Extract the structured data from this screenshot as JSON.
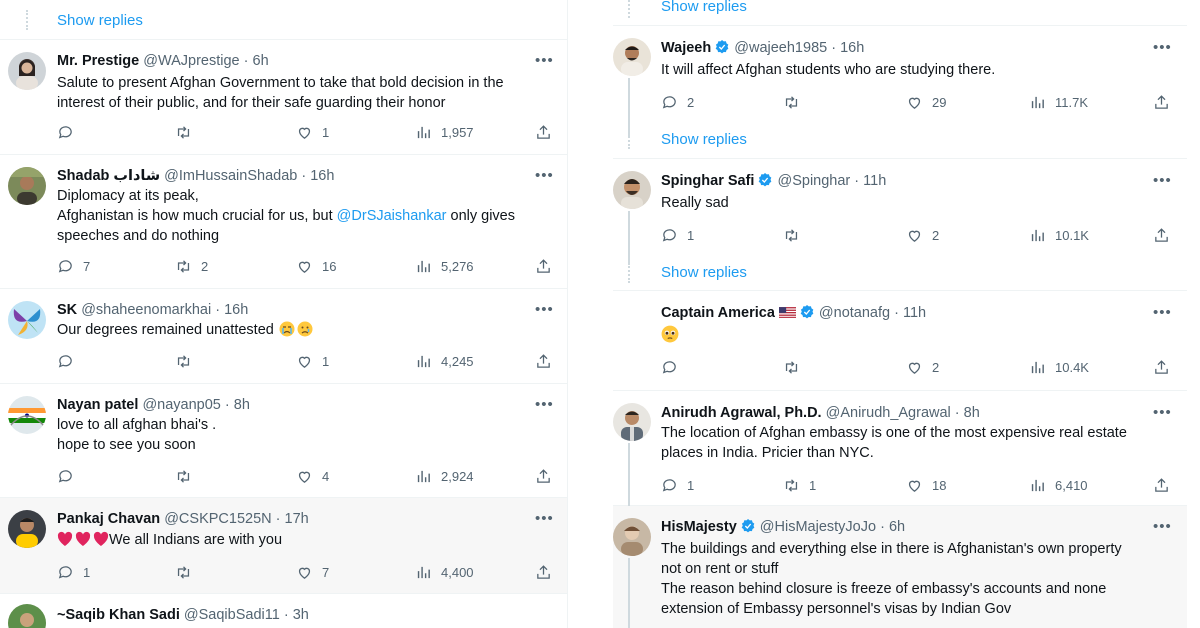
{
  "colors": {
    "accent": "#1d9bf0",
    "muted": "#536471",
    "text": "#0f1419",
    "like_red": "#f91880"
  },
  "left": {
    "show_replies": "Show replies",
    "tweets": [
      {
        "name": "Mr. Prestige",
        "handle": "@WAJprestige",
        "time": "6h",
        "lines": [
          "Salute to present Afghan Government to take that bold decision in the",
          "interest of their public, and for their safe guarding their honor"
        ],
        "replies": "",
        "retweets": "",
        "likes": "1",
        "views": "1,957"
      },
      {
        "name": "Shadab شاداب",
        "handle": "@ImHussainShadab",
        "time": "16h",
        "line1": "Diplomacy at its peak,",
        "line2_pre": "Afghanistan is how much crucial for us, but ",
        "mention": "@DrSJaishankar",
        "line2_post": " only gives",
        "line3": "speeches and do nothing",
        "replies": "7",
        "retweets": "2",
        "likes": "16",
        "views": "5,276"
      },
      {
        "name": "SK",
        "handle": "@shaheenomarkhai",
        "time": "16h",
        "text": "Our degrees remained unattested",
        "replies": "",
        "retweets": "",
        "likes": "1",
        "views": "4,245"
      },
      {
        "name": "Nayan patel",
        "handle": "@nayanp05",
        "time": "8h",
        "lines": [
          "love to all afghan bhai's .",
          "hope to see you soon"
        ],
        "replies": "",
        "retweets": "",
        "likes": "4",
        "views": "2,924"
      },
      {
        "name": "Pankaj Chavan",
        "handle": "@CSKPC1525N",
        "time": "17h",
        "text": "We all Indians are with you",
        "replies": "1",
        "retweets": "",
        "likes": "7",
        "views": "4,400"
      },
      {
        "name": "~Saqib Khan Sadi",
        "handle": "@SaqibSadi11",
        "time": "3h"
      }
    ]
  },
  "right": {
    "show_replies": "Show replies",
    "tweets": [
      {
        "name": "Wajeeh",
        "handle": "@wajeeh1985",
        "time": "16h",
        "text": "It will affect Afghan students who are studying there.",
        "replies": "2",
        "retweets": "",
        "likes": "29",
        "views": "11.7K"
      },
      {
        "name": "Spinghar Safi",
        "handle": "@Spinghar",
        "time": "11h",
        "text": "Really sad",
        "replies": "1",
        "retweets": "",
        "likes": "2",
        "views": "10.1K"
      },
      {
        "name": "Captain America",
        "handle": "@notanafg",
        "time": "11h",
        "replies": "",
        "retweets": "",
        "likes": "2",
        "views": "10.4K"
      },
      {
        "name": "Anirudh Agrawal, Ph.D.",
        "handle": "@Anirudh_Agrawal",
        "time": "8h",
        "lines": [
          "The location of Afghan embassy is one of the most expensive real estate",
          "places in India. Pricier than NYC."
        ],
        "replies": "1",
        "retweets": "1",
        "likes": "18",
        "views": "6,410"
      },
      {
        "name": "HisMajesty",
        "handle": "@HisMajestyJoJo",
        "time": "6h",
        "lines": [
          "The buildings and everything else in there is Afghanistan's own property",
          "not on rent or stuff",
          "The reason behind closure is freeze of embassy's accounts and none",
          "extension of Embassy personnel's visas by Indian Gov"
        ]
      }
    ]
  },
  "icons": {
    "reply": "reply-icon",
    "retweet": "retweet-icon",
    "like": "like-icon",
    "views": "views-icon",
    "share": "share-icon",
    "more": "more-icon",
    "verified": "verified-badge-icon"
  }
}
